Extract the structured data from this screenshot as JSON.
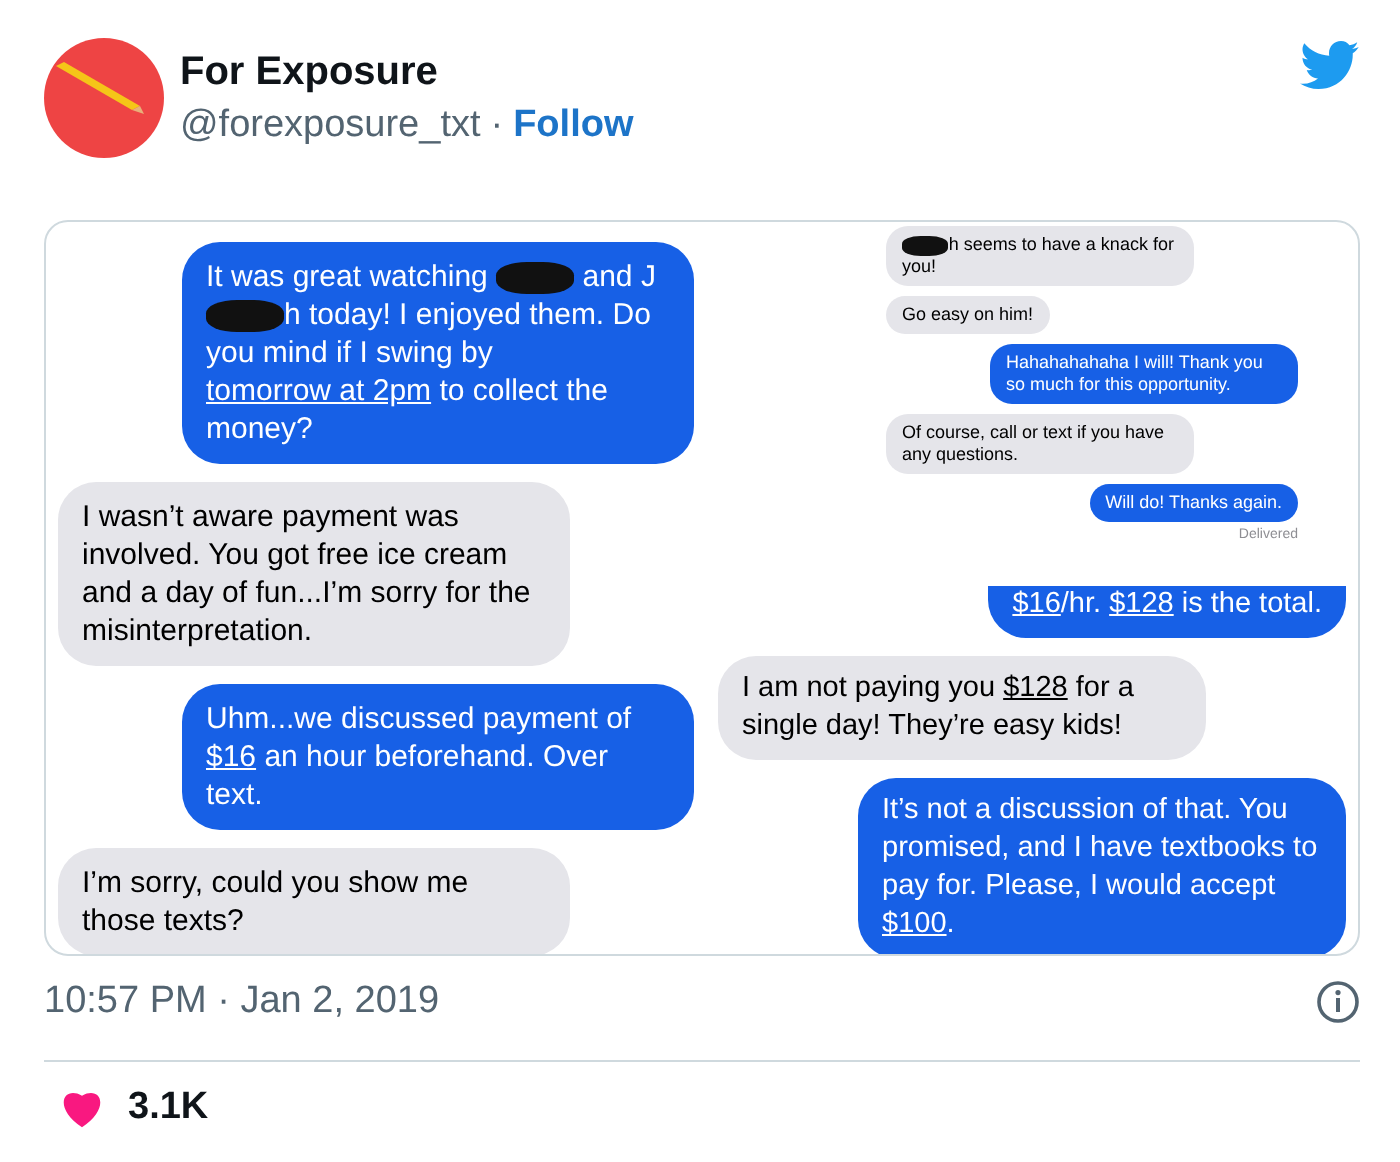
{
  "tweet": {
    "author": {
      "name": "For Exposure",
      "handle": "@forexposure_txt",
      "separator": "·",
      "follow": "Follow"
    },
    "panels": [
      {
        "kind": "large",
        "messages": [
          {
            "kind": "sent",
            "segments": [
              {
                "kind": "text",
                "text": "It was great watching "
              },
              {
                "kind": "redaction"
              },
              {
                "kind": "text",
                "text": " and J"
              },
              {
                "kind": "redaction"
              },
              {
                "kind": "text",
                "text": "h today! I enjoyed them. Do you mind if I swing by "
              },
              {
                "kind": "link",
                "text": "tomorrow at 2pm"
              },
              {
                "kind": "text",
                "text": " to collect the money?"
              }
            ]
          },
          {
            "kind": "received",
            "segments": [
              {
                "kind": "text",
                "text": "I wasn’t aware payment was involved. You got free ice cream and a day of fun...I’m sorry for the misinterpretation."
              }
            ]
          },
          {
            "kind": "sent",
            "segments": [
              {
                "kind": "text",
                "text": "Uhm...we discussed payment of "
              },
              {
                "kind": "link",
                "text": "$16"
              },
              {
                "kind": "text",
                "text": " an hour beforehand. Over text."
              }
            ]
          },
          {
            "kind": "received",
            "segments": [
              {
                "kind": "text",
                "text": "I’m sorry, could you show me those texts?"
              }
            ]
          }
        ]
      },
      {
        "kind": "small",
        "messages": [
          {
            "kind": "received",
            "segments": [
              {
                "kind": "redaction"
              },
              {
                "kind": "text",
                "text": "h seems to have a knack for you!"
              }
            ]
          },
          {
            "kind": "received",
            "segments": [
              {
                "kind": "text",
                "text": "Go easy on him!"
              }
            ]
          },
          {
            "kind": "sent",
            "segments": [
              {
                "kind": "text",
                "text": "Hahahahahaha I will! Thank you so much for this opportunity."
              }
            ]
          },
          {
            "kind": "received",
            "segments": [
              {
                "kind": "text",
                "text": "Of course, call or text if you have any questions."
              }
            ]
          },
          {
            "kind": "sent",
            "segments": [
              {
                "kind": "text",
                "text": "Will do! Thanks again."
              }
            ]
          },
          {
            "kind": "status",
            "text": "Delivered"
          }
        ]
      },
      {
        "kind": "medium",
        "messages": [
          {
            "kind": "sliver"
          },
          {
            "kind": "clipped",
            "segments": [
              {
                "kind": "link",
                "text": "$16"
              },
              {
                "kind": "text",
                "text": "/hr. "
              },
              {
                "kind": "link",
                "text": "$128"
              },
              {
                "kind": "text",
                "text": " is the total."
              }
            ]
          },
          {
            "kind": "received",
            "segments": [
              {
                "kind": "text",
                "text": "I am not paying you "
              },
              {
                "kind": "link",
                "text": "$128"
              },
              {
                "kind": "text",
                "text": " for a single day! They’re easy kids!"
              }
            ]
          },
          {
            "kind": "sent",
            "segments": [
              {
                "kind": "text",
                "text": "It’s not a discussion of that. You promised, and I have textbooks to pay for. Please, I would accept "
              },
              {
                "kind": "link",
                "text": "$100"
              },
              {
                "kind": "text",
                "text": "."
              }
            ]
          }
        ]
      }
    ],
    "timestamp": "10:57 PM · Jan 2, 2019",
    "likes": "3.1K"
  }
}
